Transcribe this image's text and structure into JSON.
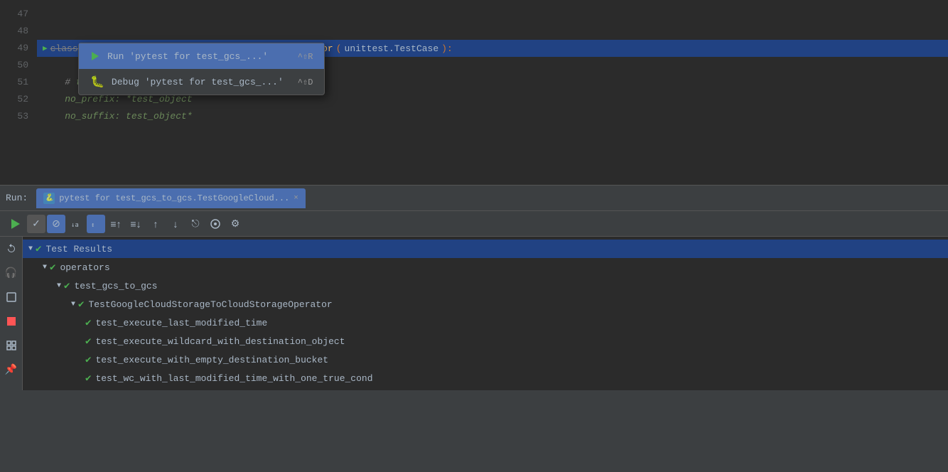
{
  "editor": {
    "lines": [
      {
        "num": "47",
        "content": "",
        "highlight": false
      },
      {
        "num": "48",
        "content": "",
        "highlight": false
      },
      {
        "num": "49",
        "content": "class TestGoogleCloudStorageToCloudStorageOperator(unittest.TestCase):",
        "highlight": true
      },
      {
        "num": "50",
        "content": "",
        "highlight": false
      },
      {
        "num": "51",
        "content": "    # the wildcard operator. These are",
        "highlight": false
      },
      {
        "num": "52",
        "content": "    no_prefix: *test_object",
        "highlight": false
      },
      {
        "num": "53",
        "content": "    no_suffix: test_object*",
        "highlight": false
      }
    ]
  },
  "context_menu": {
    "items": [
      {
        "id": "run",
        "label": "Run 'pytest for test_gcs_...'",
        "shortcut": "^⇧R",
        "icon": "play"
      },
      {
        "id": "debug",
        "label": "Debug 'pytest for test_gcs_...'",
        "shortcut": "^⇧D",
        "icon": "bug"
      }
    ]
  },
  "run_panel": {
    "label": "Run:",
    "tab_label": "pytest for test_gcs_to_gcs.TestGoogleCloud...",
    "close_label": "×"
  },
  "toolbar": {
    "buttons": [
      "▶",
      "✓",
      "⊘",
      "↓a",
      "↕",
      "≡↑",
      "≡↓",
      "↑",
      "↓",
      "⎋",
      "⊙",
      "⚙"
    ]
  },
  "side_icons": {
    "icons": [
      "↩",
      "🎧",
      "⊡",
      "■",
      "⊞",
      "📌"
    ]
  },
  "test_results": {
    "title": "Test Results",
    "tree": [
      {
        "level": 0,
        "label": "Test Results",
        "has_check": true,
        "has_chevron": true
      },
      {
        "level": 1,
        "label": "operators",
        "has_check": true,
        "has_chevron": true
      },
      {
        "level": 2,
        "label": "test_gcs_to_gcs",
        "has_check": true,
        "has_chevron": true
      },
      {
        "level": 3,
        "label": "TestGoogleCloudStorageToCloudStorageOperator",
        "has_check": true,
        "has_chevron": true
      },
      {
        "level": 4,
        "label": "test_execute_last_modified_time",
        "has_check": true,
        "has_chevron": false
      },
      {
        "level": 4,
        "label": "test_execute_wildcard_with_destination_object",
        "has_check": true,
        "has_chevron": false
      },
      {
        "level": 4,
        "label": "test_execute_with_empty_destination_bucket",
        "has_check": true,
        "has_chevron": false
      },
      {
        "level": 4,
        "label": "test_wc_with_last_modified_time_with_one_true_cond",
        "has_check": true,
        "has_chevron": false
      }
    ]
  }
}
